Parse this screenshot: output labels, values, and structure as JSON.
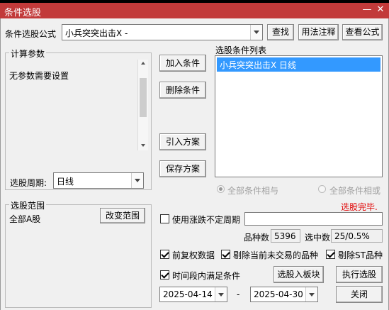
{
  "window": {
    "title": "条件选股",
    "minimize_glyph": "—",
    "close_glyph": "✕"
  },
  "formula": {
    "label": "条件选股公式",
    "value": "小兵突突出击X -",
    "find_button": "查找",
    "usage_button": "用法注释",
    "view_button": "查看公式"
  },
  "params": {
    "group_label": "计算参数",
    "message": "无参数需要设置",
    "period_label": "选股周期:",
    "period_value": "日线"
  },
  "actions": {
    "add": "加入条件",
    "delete": "删除条件",
    "import": "引入方案",
    "save": "保存方案"
  },
  "conditions": {
    "label": "选股条件列表",
    "items": [
      "小兵突突出击X  日线"
    ],
    "all_and": "全部条件相与",
    "all_or": "全部条件相或"
  },
  "status": {
    "text": "选股完毕.",
    "color": "#e00000"
  },
  "range": {
    "group_label": "选股范围",
    "value": "全部A股",
    "change_button": "改变范围"
  },
  "options": {
    "irregular_period": "使用涨跌不定周期",
    "irregular_checked": false,
    "count_label": "品种数",
    "count_value": "5396",
    "selected_label": "选中数",
    "selected_value": "25/0.5%",
    "forward_adjust": "前复权数据",
    "forward_checked": true,
    "exclude_untraded": "剔除当前未交易的品种",
    "exclude_untraded_checked": true,
    "exclude_st": "剔除ST品种",
    "exclude_st_checked": true,
    "time_range": "时间段内满足条件",
    "time_range_checked": true,
    "to_block_button": "选股入板块",
    "run_button": "执行选股",
    "start_date": "2025-04-14",
    "dash": "-",
    "end_date": "2025-04-30",
    "close_button": "关闭"
  },
  "colors": {
    "titlebar": "#c23a3a",
    "selection": "#3399ff"
  }
}
